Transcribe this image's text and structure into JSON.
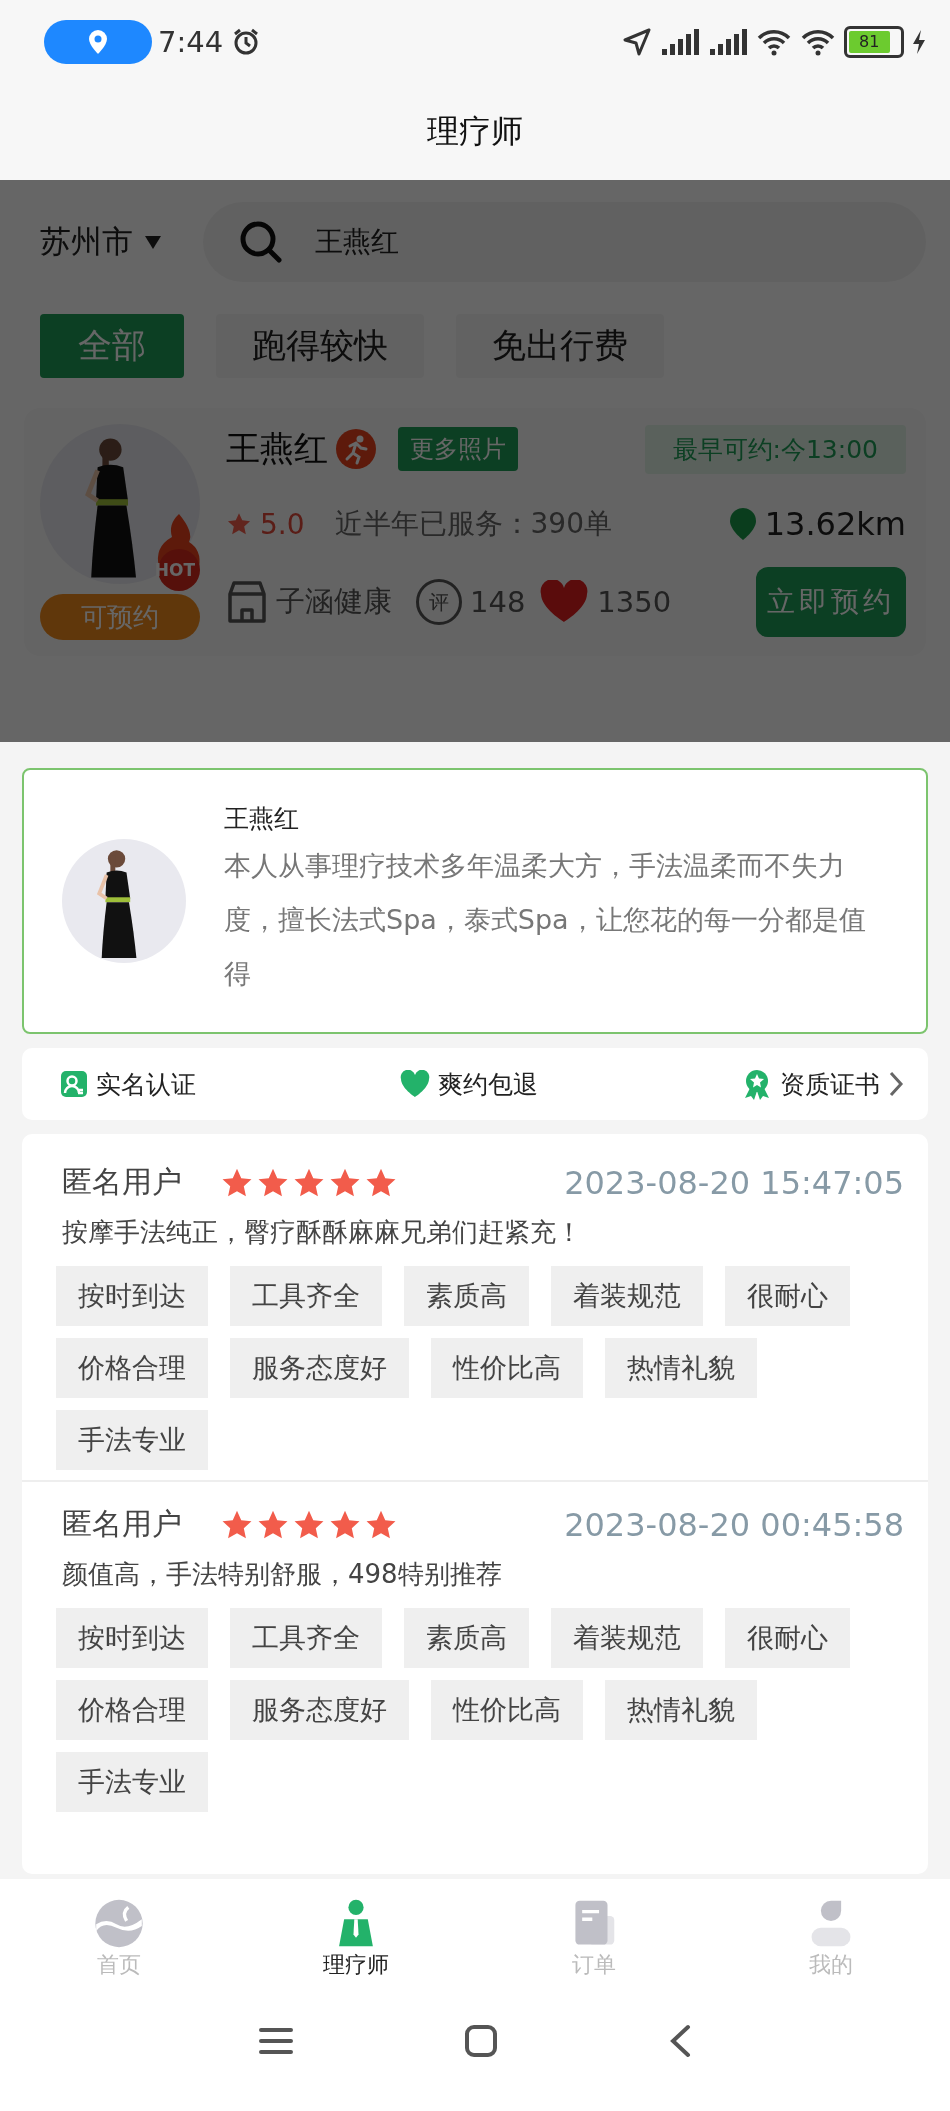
{
  "status_bar": {
    "time": "7:44",
    "battery": "81"
  },
  "header": {
    "title": "理疗师"
  },
  "filter": {
    "city": "苏州市",
    "search_value": "王燕红"
  },
  "chips": [
    {
      "label": "全部",
      "selected": true
    },
    {
      "label": "跑得较快",
      "selected": false
    },
    {
      "label": "免出行费",
      "selected": false
    }
  ],
  "therapist_card": {
    "name": "王燕红",
    "hot_badge": "HOT",
    "more_photos": "更多照片",
    "earliest": "最早可约:今13:00",
    "rating": "5.0",
    "served": "近半年已服务：390单",
    "distance": "13.62km",
    "status": "可预约",
    "shop": "子涵健康",
    "comment_badge": "评",
    "reviews_count": "148",
    "likes": "1350",
    "book_button": "立即预约"
  },
  "profile": {
    "name": "王燕红",
    "bio": "本人从事理疗技术多年温柔大方，手法温柔而不失力度，擅长法式Spa，泰式Spa，让您花的每一分都是值得"
  },
  "guarantees": [
    {
      "kind": "verified",
      "label": "实名认证"
    },
    {
      "kind": "refund",
      "label": "爽约包退"
    },
    {
      "kind": "certificate",
      "label": "资质证书"
    }
  ],
  "reviews": [
    {
      "user": "匿名用户",
      "stars": 5,
      "time": "2023-08-20 15:47:05",
      "text": "按摩手法纯正，臀疗酥酥麻麻兄弟们赶紧充！",
      "tags": [
        "按时到达",
        "工具齐全",
        "素质高",
        "着装规范",
        "很耐心",
        "价格合理",
        "服务态度好",
        "性价比高",
        "热情礼貌",
        "手法专业"
      ]
    },
    {
      "user": "匿名用户",
      "stars": 5,
      "time": "2023-08-20 00:45:58",
      "text": "颜值高，手法特别舒服，498特别推荐",
      "tags": [
        "按时到达",
        "工具齐全",
        "素质高",
        "着装规范",
        "很耐心",
        "价格合理",
        "服务态度好",
        "性价比高",
        "热情礼貌",
        "手法专业"
      ]
    }
  ],
  "tabs": [
    {
      "kind": "home",
      "label": "首页",
      "selected": false
    },
    {
      "kind": "therapist",
      "label": "理疗师",
      "selected": true
    },
    {
      "kind": "orders",
      "label": "订单",
      "selected": false
    },
    {
      "kind": "mine",
      "label": "我的",
      "selected": false
    }
  ]
}
